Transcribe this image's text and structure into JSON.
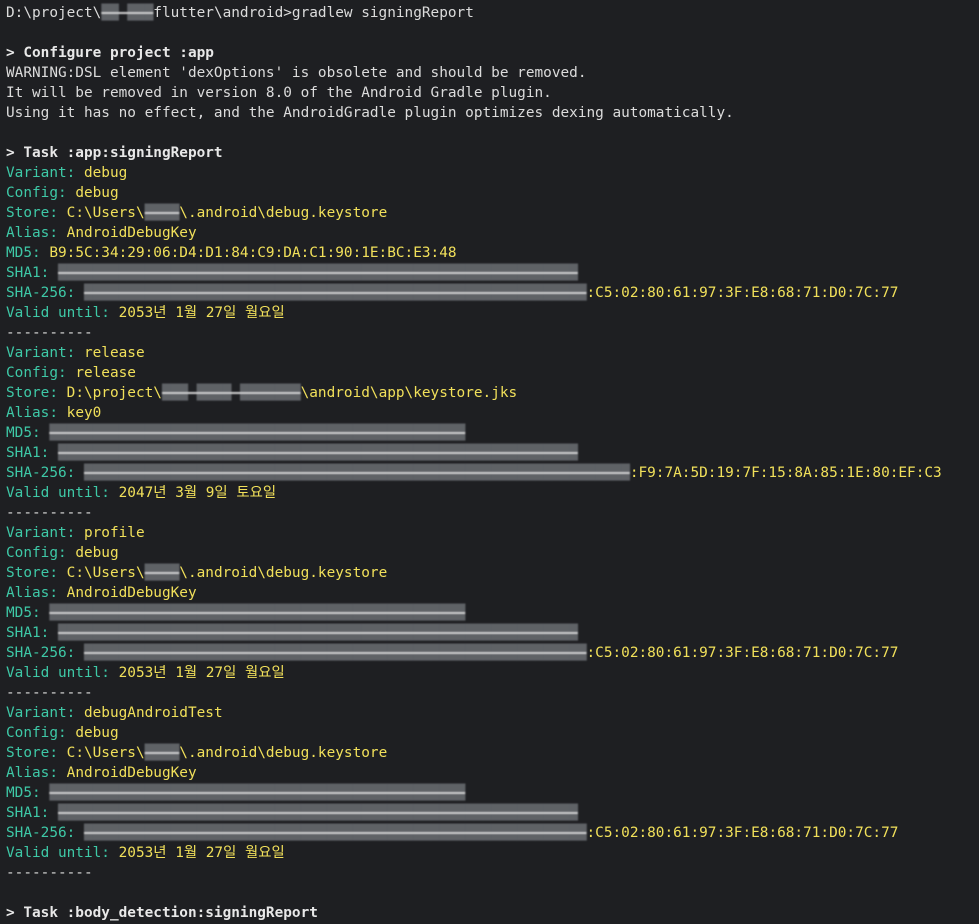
{
  "colors": {
    "background": "#1e1f22",
    "default_text": "#dcdcdc",
    "key_text": "#3ec9a7",
    "value_text": "#f1e05a"
  },
  "lines": [
    {
      "parts": [
        {
          "t": "D:\\project\\",
          "s": "plain"
        },
        {
          "t": "██ ███",
          "s": "redact"
        },
        {
          "t": "flutter\\android>gradlew signingReport",
          "s": "plain"
        }
      ]
    },
    {
      "parts": []
    },
    {
      "parts": [
        {
          "t": "> Configure project :app",
          "s": "bold"
        }
      ]
    },
    {
      "parts": [
        {
          "t": "WARNING:DSL element 'dexOptions' is obsolete and should be removed.",
          "s": "plain"
        }
      ]
    },
    {
      "parts": [
        {
          "t": "It will be removed in version 8.0 of the Android Gradle plugin.",
          "s": "plain"
        }
      ]
    },
    {
      "parts": [
        {
          "t": "Using it has no effect, and the AndroidGradle plugin optimizes dexing automatically.",
          "s": "plain"
        }
      ]
    },
    {
      "parts": []
    },
    {
      "parts": [
        {
          "t": "> Task :app:signingReport",
          "s": "bold"
        }
      ]
    },
    {
      "parts": [
        {
          "t": "Variant: ",
          "s": "key"
        },
        {
          "t": "debug",
          "s": "val"
        }
      ]
    },
    {
      "parts": [
        {
          "t": "Config: ",
          "s": "key"
        },
        {
          "t": "debug",
          "s": "val"
        }
      ]
    },
    {
      "parts": [
        {
          "t": "Store: ",
          "s": "key"
        },
        {
          "t": "C:\\Users\\",
          "s": "val"
        },
        {
          "t": "████",
          "s": "redact"
        },
        {
          "t": "\\.android\\debug.keystore",
          "s": "val"
        }
      ]
    },
    {
      "parts": [
        {
          "t": "Alias: ",
          "s": "key"
        },
        {
          "t": "AndroidDebugKey",
          "s": "val"
        }
      ]
    },
    {
      "parts": [
        {
          "t": "MD5: ",
          "s": "key"
        },
        {
          "t": "B9:5C:34:29:06:D4:D1:84:C9:DA:C1:90:1E:BC:E3:48",
          "s": "val"
        }
      ]
    },
    {
      "parts": [
        {
          "t": "SHA1: ",
          "s": "key"
        },
        {
          "t": "████████████████████████████████████████████████████████████",
          "s": "redact"
        }
      ]
    },
    {
      "parts": [
        {
          "t": "SHA-256: ",
          "s": "key"
        },
        {
          "t": "██████████████████████████████████████████████████████████",
          "s": "redact"
        },
        {
          "t": ":C5:02:80:61:97:3F:E8:68:71:D0:7C:77",
          "s": "val"
        }
      ]
    },
    {
      "parts": [
        {
          "t": "Valid until: ",
          "s": "key"
        },
        {
          "t": "2053년 1월 27일 월요일",
          "s": "val"
        }
      ]
    },
    {
      "parts": [
        {
          "t": "----------",
          "s": "plain"
        }
      ]
    },
    {
      "parts": [
        {
          "t": "Variant: ",
          "s": "key"
        },
        {
          "t": "release",
          "s": "val"
        }
      ]
    },
    {
      "parts": [
        {
          "t": "Config: ",
          "s": "key"
        },
        {
          "t": "release",
          "s": "val"
        }
      ]
    },
    {
      "parts": [
        {
          "t": "Store: ",
          "s": "key"
        },
        {
          "t": "D:\\project\\",
          "s": "val"
        },
        {
          "t": "███ ████ ███████",
          "s": "redact"
        },
        {
          "t": "\\android\\app\\keystore.jks",
          "s": "val"
        }
      ]
    },
    {
      "parts": [
        {
          "t": "Alias: ",
          "s": "key"
        },
        {
          "t": "key0",
          "s": "val"
        }
      ]
    },
    {
      "parts": [
        {
          "t": "MD5: ",
          "s": "key"
        },
        {
          "t": "████████████████████████████████████████████████",
          "s": "redact"
        }
      ]
    },
    {
      "parts": [
        {
          "t": "SHA1: ",
          "s": "key"
        },
        {
          "t": "████████████████████████████████████████████████████████████",
          "s": "redact"
        }
      ]
    },
    {
      "parts": [
        {
          "t": "SHA-256: ",
          "s": "key"
        },
        {
          "t": "███████████████████████████████████████████████████████████████",
          "s": "redact"
        },
        {
          "t": ":F9:7A:5D:19:7F:15:8A:85:1E:80:EF:C3",
          "s": "val"
        }
      ]
    },
    {
      "parts": [
        {
          "t": "Valid until: ",
          "s": "key"
        },
        {
          "t": "2047년 3월 9일 토요일",
          "s": "val"
        }
      ]
    },
    {
      "parts": [
        {
          "t": "----------",
          "s": "plain"
        }
      ]
    },
    {
      "parts": [
        {
          "t": "Variant: ",
          "s": "key"
        },
        {
          "t": "profile",
          "s": "val"
        }
      ]
    },
    {
      "parts": [
        {
          "t": "Config: ",
          "s": "key"
        },
        {
          "t": "debug",
          "s": "val"
        }
      ]
    },
    {
      "parts": [
        {
          "t": "Store: ",
          "s": "key"
        },
        {
          "t": "C:\\Users\\",
          "s": "val"
        },
        {
          "t": "████",
          "s": "redact"
        },
        {
          "t": "\\.android\\debug.keystore",
          "s": "val"
        }
      ]
    },
    {
      "parts": [
        {
          "t": "Alias: ",
          "s": "key"
        },
        {
          "t": "AndroidDebugKey",
          "s": "val"
        }
      ]
    },
    {
      "parts": [
        {
          "t": "MD5: ",
          "s": "key"
        },
        {
          "t": "████████████████████████████████████████████████",
          "s": "redact"
        }
      ]
    },
    {
      "parts": [
        {
          "t": "SHA1: ",
          "s": "key"
        },
        {
          "t": "████████████████████████████████████████████████████████████",
          "s": "redact"
        }
      ]
    },
    {
      "parts": [
        {
          "t": "SHA-256: ",
          "s": "key"
        },
        {
          "t": "██████████████████████████████████████████████████████████",
          "s": "redact"
        },
        {
          "t": ":C5:02:80:61:97:3F:E8:68:71:D0:7C:77",
          "s": "val"
        }
      ]
    },
    {
      "parts": [
        {
          "t": "Valid until: ",
          "s": "key"
        },
        {
          "t": "2053년 1월 27일 월요일",
          "s": "val"
        }
      ]
    },
    {
      "parts": [
        {
          "t": "----------",
          "s": "plain"
        }
      ]
    },
    {
      "parts": [
        {
          "t": "Variant: ",
          "s": "key"
        },
        {
          "t": "debugAndroidTest",
          "s": "val"
        }
      ]
    },
    {
      "parts": [
        {
          "t": "Config: ",
          "s": "key"
        },
        {
          "t": "debug",
          "s": "val"
        }
      ]
    },
    {
      "parts": [
        {
          "t": "Store: ",
          "s": "key"
        },
        {
          "t": "C:\\Users\\",
          "s": "val"
        },
        {
          "t": "████",
          "s": "redact"
        },
        {
          "t": "\\.android\\debug.keystore",
          "s": "val"
        }
      ]
    },
    {
      "parts": [
        {
          "t": "Alias: ",
          "s": "key"
        },
        {
          "t": "AndroidDebugKey",
          "s": "val"
        }
      ]
    },
    {
      "parts": [
        {
          "t": "MD5: ",
          "s": "key"
        },
        {
          "t": "████████████████████████████████████████████████",
          "s": "redact"
        }
      ]
    },
    {
      "parts": [
        {
          "t": "SHA1: ",
          "s": "key"
        },
        {
          "t": "████████████████████████████████████████████████████████████",
          "s": "redact"
        }
      ]
    },
    {
      "parts": [
        {
          "t": "SHA-256: ",
          "s": "key"
        },
        {
          "t": "██████████████████████████████████████████████████████████",
          "s": "redact"
        },
        {
          "t": ":C5:02:80:61:97:3F:E8:68:71:D0:7C:77",
          "s": "val"
        }
      ]
    },
    {
      "parts": [
        {
          "t": "Valid until: ",
          "s": "key"
        },
        {
          "t": "2053년 1월 27일 월요일",
          "s": "val"
        }
      ]
    },
    {
      "parts": [
        {
          "t": "----------",
          "s": "plain"
        }
      ]
    },
    {
      "parts": []
    },
    {
      "parts": [
        {
          "t": "> Task :body_detection:signingReport",
          "s": "bold"
        }
      ]
    }
  ]
}
